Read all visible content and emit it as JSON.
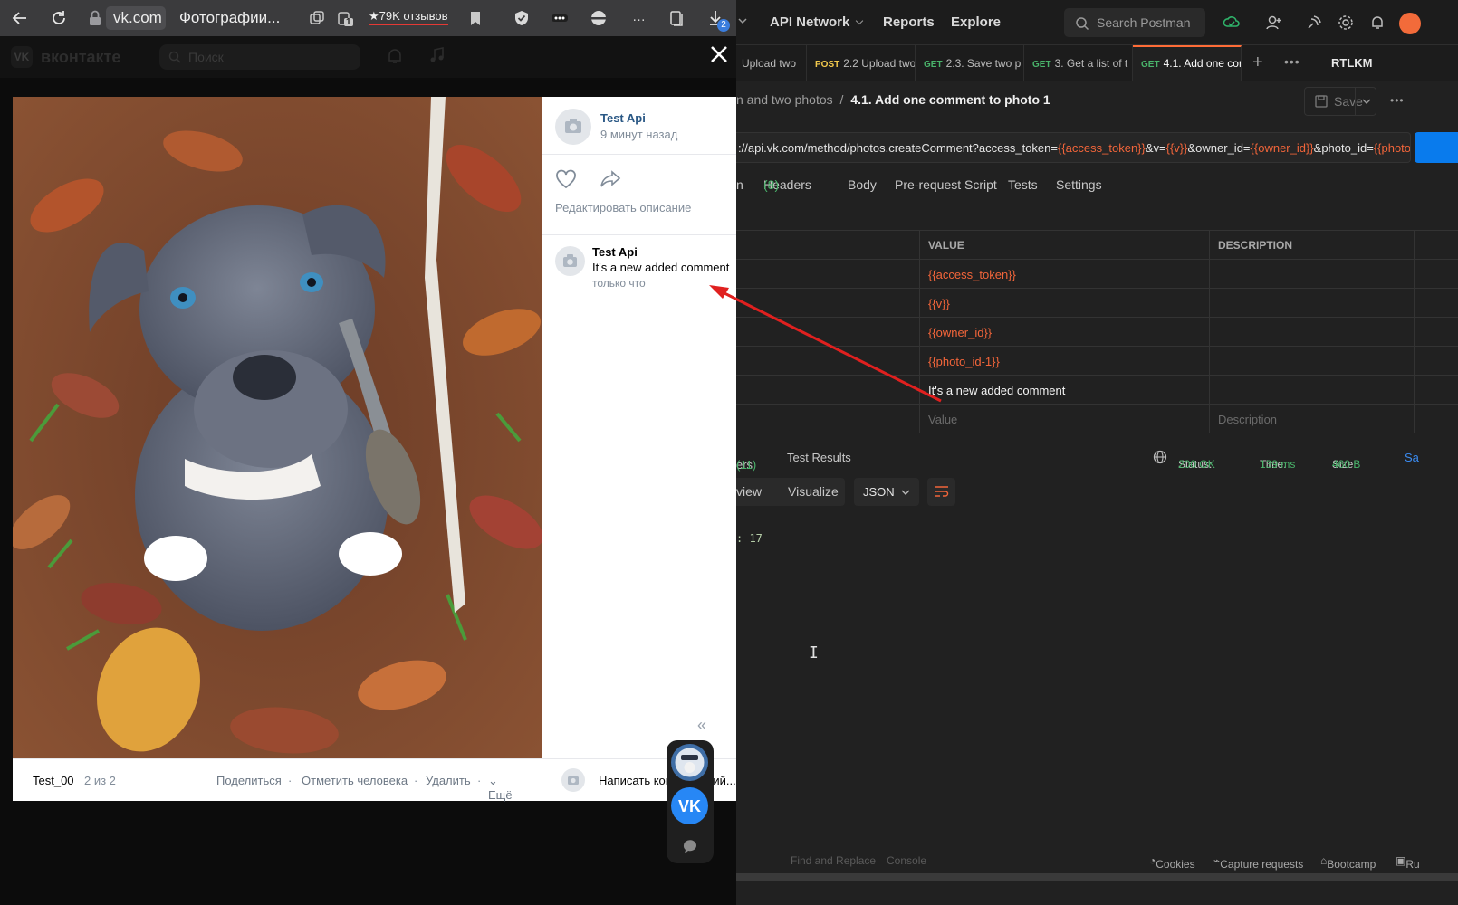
{
  "browser": {
    "host": "vk.com",
    "tab_title": "Фотографии...",
    "reviews": "★79K отзывов",
    "download_badge": "2",
    "tab_counter": "1"
  },
  "vk": {
    "brand": "вконтакте",
    "search_placeholder": "Поиск",
    "photo": {
      "author": "Test Api",
      "posted": "9 минут назад",
      "edit_description": "Редактировать описание"
    },
    "comment": {
      "author": "Test Api",
      "text": "It's a new added comment",
      "time": "только что"
    },
    "bottom_bar": {
      "album": "Test_00",
      "counter": "2 из 2",
      "share": "Поделиться",
      "tag_person": "Отметить человека",
      "delete": "Удалить",
      "more": "Ещё",
      "write_comment": "Написать комментарий..."
    }
  },
  "postman": {
    "nav": [
      "API Network",
      "Reports",
      "Explore"
    ],
    "search_placeholder": "Search Postman",
    "tabs": [
      {
        "method": "",
        "label": "Upload two"
      },
      {
        "method": "POST",
        "label": "2.2 Upload two"
      },
      {
        "method": "GET",
        "label": "2.3. Save two p"
      },
      {
        "method": "GET",
        "label": "3. Get a list of t"
      },
      {
        "method": "GET",
        "label": "4.1. Add one com"
      }
    ],
    "environment": "RTLKM",
    "breadcrumb_parent": "n and two photos",
    "breadcrumb_sep": "/",
    "breadcrumb_current": "4.1. Add one comment to photo 1",
    "save_label": "Save",
    "url_segments": [
      {
        "text": "://api.vk.com/method/photos.createComment?access_token=",
        "var": false
      },
      {
        "text": "{{access_token}}",
        "var": true
      },
      {
        "text": "&v=",
        "var": false
      },
      {
        "text": "{{v}}",
        "var": true
      },
      {
        "text": "&owner_id=",
        "var": false
      },
      {
        "text": "{{owner_id}}",
        "var": true
      },
      {
        "text": "&photo_id=",
        "var": false
      },
      {
        "text": "{{photo_i...",
        "var": true
      }
    ],
    "request_tabs": {
      "params_fragment": "n",
      "headers": "Headers",
      "headers_count": "(8)",
      "body": "Body",
      "prerequest": "Pre-request Script",
      "tests": "Tests",
      "settings": "Settings"
    },
    "params_table": {
      "headers": [
        "VALUE",
        "DESCRIPTION"
      ],
      "rows": [
        {
          "value": "{{access_token}}",
          "is_var": true
        },
        {
          "value": "{{v}}",
          "is_var": true
        },
        {
          "value": "{{owner_id}}",
          "is_var": true
        },
        {
          "value": "{{photo_id-1}}",
          "is_var": true
        },
        {
          "value": "It's a new added comment",
          "is_var": false
        }
      ],
      "value_placeholder": "Value",
      "description_placeholder": "Description"
    },
    "response": {
      "headers_tab": "ers",
      "headers_count": "(11)",
      "test_results": "Test Results",
      "status_label": "Status:",
      "status": "200 OK",
      "time_label": "Time:",
      "time": "139 ms",
      "size_label": "Size:",
      "size": "460 B",
      "save_fragment": "Sa",
      "view_tab": "view",
      "visualize": "Visualize",
      "format": "JSON",
      "body_line": ": 17"
    },
    "footer": {
      "find": "Find and Replace",
      "console": "Console",
      "cookies": "Cookies",
      "capture": "Capture requests",
      "bootcamp": "Bootcamp",
      "runner_fragment": "Ru"
    }
  },
  "colors": {
    "postman_variable": "#f2653a",
    "postman_success": "#49b36a",
    "postman_accent": "#ff6c37",
    "vk_link": "#2a5885",
    "annotation_arrow": "#e0201f"
  }
}
